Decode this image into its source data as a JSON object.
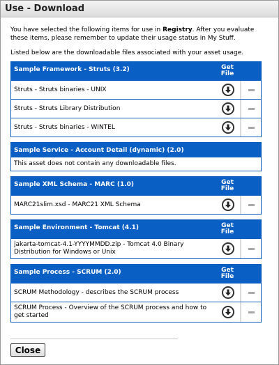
{
  "window": {
    "title": "Use - Download"
  },
  "intro": {
    "text_before": "You have selected the following items for use in ",
    "registry": "Registry",
    "text_after": ". After you evaluate these items, please remember to update their usage status in My Stuff."
  },
  "listed": "Listed below are the downloadable files associated with your asset usage.",
  "get_file_line1": "Get",
  "get_file_line2": "File",
  "groups": [
    {
      "title": "Sample Framework - Struts (3.2)",
      "rows": [
        "Struts - Struts binaries - UNIX",
        "Struts - Struts Library Distribution",
        "Struts - Struts binaries - WINTEL"
      ]
    },
    {
      "title": "Sample Service - Account Detail (dynamic) (2.0)",
      "no_files": "This asset does not contain any downloadable files."
    },
    {
      "title": "Sample XML Schema - MARC (1.0)",
      "rows": [
        "MARC21slim.xsd - MARC21 XML Schema"
      ]
    },
    {
      "title": "Sample Environment - Tomcat (4.1)",
      "rows": [
        "jakarta-tomcat-4.1-YYYYMMDD.zip - Tomcat 4.0 Binary Distribution for Windows or Unix"
      ]
    },
    {
      "title": "Sample Process - SCRUM (2.0)",
      "rows": [
        "SCRUM Methodology - describes the SCRUM process",
        "SCRUM Process - Overview of the SCRUM process and how to get started"
      ]
    }
  ],
  "icons": {
    "download": "download-arrow-icon",
    "remove": "remove-dash-icon"
  },
  "colors": {
    "header_blue": "#0a5fc4"
  },
  "buttons": {
    "close": "Close"
  }
}
